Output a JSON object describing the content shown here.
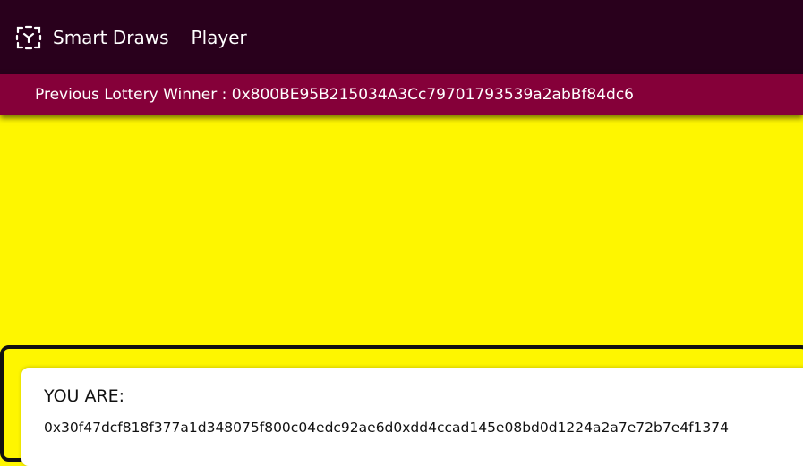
{
  "navbar": {
    "brand_icon": "dashed-square-logo-icon",
    "brand_name": "Smart Draws",
    "player_link": "Player"
  },
  "winner_bar": {
    "text": "Previous Lottery Winner : 0x800BE95B215034A3Cc79701793539a2abBf84dc6"
  },
  "player_card": {
    "label": "YOU ARE:",
    "address": "0x30f47dcf818f377a1d348075f800c04edc92ae6d0xdd4ccad145e08bd0d1224a2a7e72b7e4f1374"
  },
  "colors": {
    "navbar_bg": "#29001c",
    "winner_bar_bg": "#850039",
    "page_bg": "#fef600",
    "card_bg": "#ffffff"
  }
}
